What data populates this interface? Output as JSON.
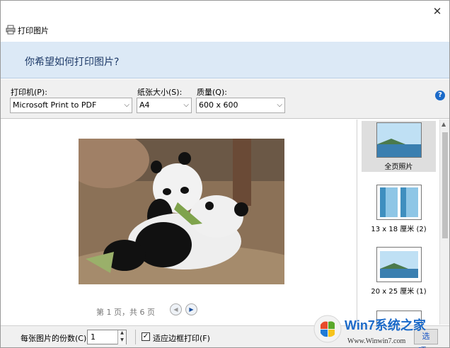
{
  "window": {
    "title": "打印图片",
    "close_glyph": "✕",
    "title_icon": "printer-icon"
  },
  "banner": {
    "question": "你希望如何打印图片?"
  },
  "options": {
    "printer_label": "打印机(P):",
    "printer_value": "Microsoft Print to PDF",
    "paper_label": "纸张大小(S):",
    "paper_value": "A4",
    "quality_label": "质量(Q):",
    "quality_value": "600 x 600",
    "help_glyph": "?"
  },
  "preview": {
    "page_status": "第 1 页，共 6 页",
    "prev_icon": "prev-page-icon",
    "next_icon": "next-page-icon"
  },
  "layouts": [
    {
      "label": "全页照片",
      "selected": true
    },
    {
      "label": "13 x 18 厘米 (2)",
      "selected": false
    },
    {
      "label": "20 x 25 厘米 (1)",
      "selected": false
    }
  ],
  "footer": {
    "copies_label": "每张图片的份数(C):",
    "copies_value": "1",
    "fit_label": "适应边框打印(F)",
    "fit_checked": true,
    "options_button": "选项..."
  },
  "watermark": {
    "text": "Win7系统之家",
    "url": "Www.Winwin7.com"
  },
  "colors": {
    "banner_bg": "#dce9f6",
    "banner_text": "#1e3a68",
    "accent": "#1b6ac9"
  }
}
